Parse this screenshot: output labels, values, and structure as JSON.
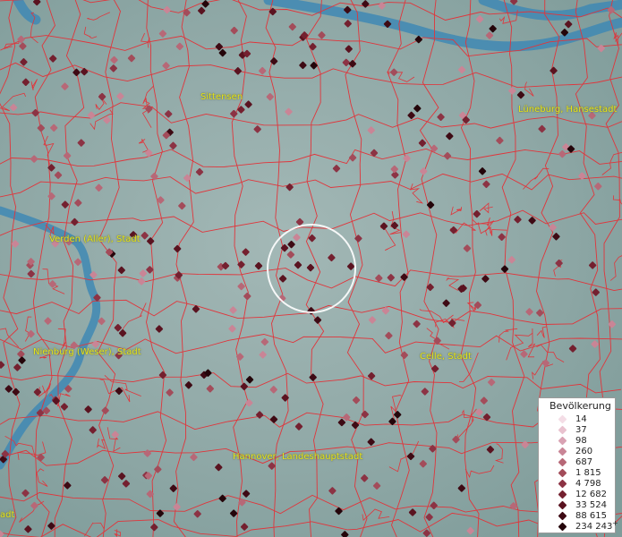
{
  "map": {
    "place_labels": [
      {
        "id": "sittensen",
        "text": "Sittensen"
      },
      {
        "id": "lueneburg",
        "text": "Lüneburg, Hansestadt"
      },
      {
        "id": "verden",
        "text": "Verden (Aller), Stadt"
      },
      {
        "id": "nienburg",
        "text": "Nienburg (Weser), Stadt"
      },
      {
        "id": "celle",
        "text": "Celle, Stadt"
      },
      {
        "id": "hannover",
        "text": "Hannover, Landeshauptstadt"
      },
      {
        "id": "left-edge",
        "text": "adt"
      }
    ],
    "colors": {
      "terrain": "#8fa8a6",
      "river": "#3f88b4",
      "border": "#e0353b",
      "label": "#e6e61a",
      "selection_ring": "#ffffff"
    }
  },
  "legend": {
    "title": "Bevölkerung",
    "items": [
      {
        "value": "14",
        "color": "#f4dde6"
      },
      {
        "value": "37",
        "color": "#e9c2cf"
      },
      {
        "value": "98",
        "color": "#d9a2b3"
      },
      {
        "value": "260",
        "color": "#c98596"
      },
      {
        "value": "687",
        "color": "#b76877"
      },
      {
        "value": "1 815",
        "color": "#a34c5a"
      },
      {
        "value": "4 798",
        "color": "#8c3344"
      },
      {
        "value": "12 682",
        "color": "#74202f"
      },
      {
        "value": "33 524",
        "color": "#5a1320"
      },
      {
        "value": "88 615",
        "color": "#3e0a14"
      },
      {
        "value": "234 243",
        "color": "#24050a"
      }
    ],
    "last_suffix": "+"
  }
}
